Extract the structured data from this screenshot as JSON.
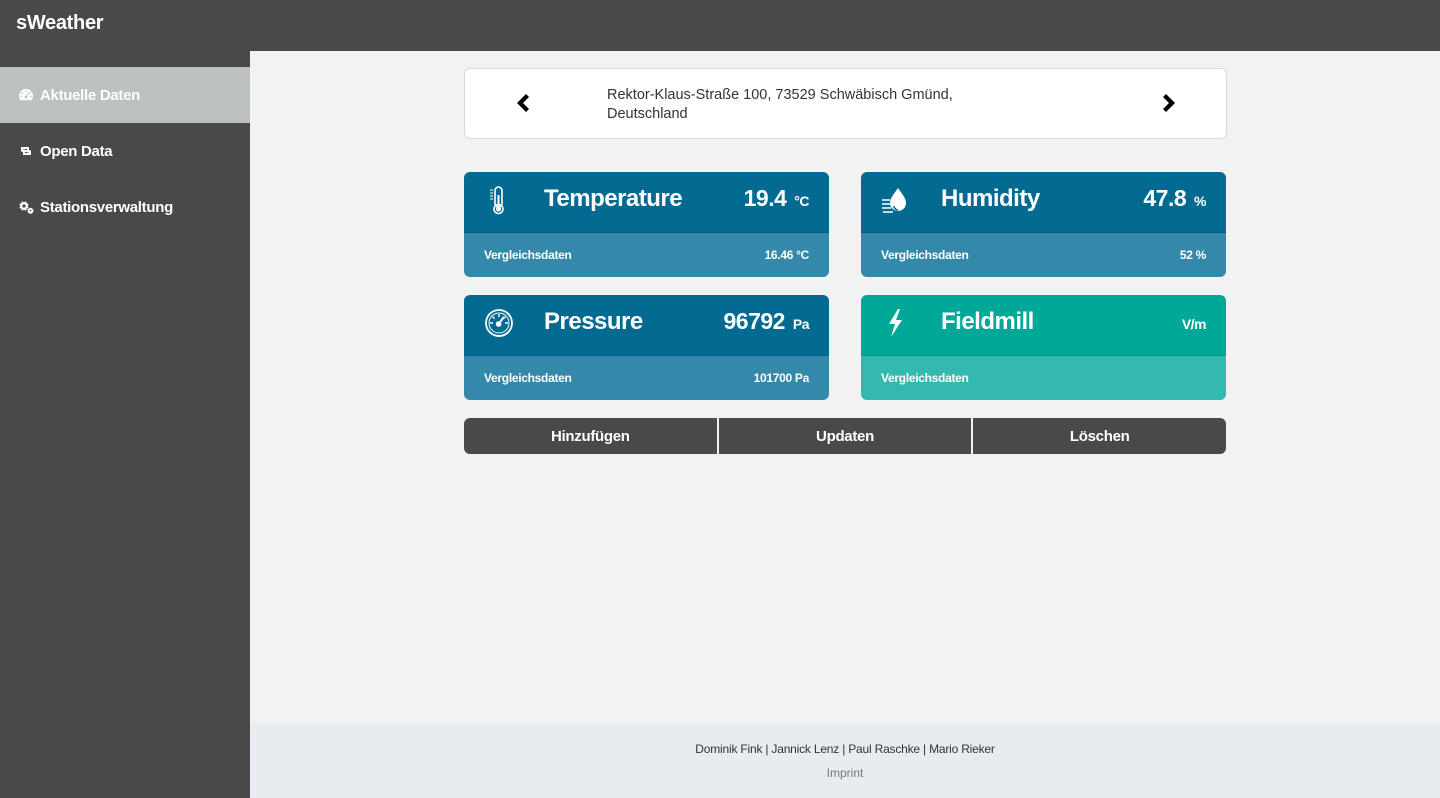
{
  "app": {
    "title": "sWeather"
  },
  "sidebar": {
    "items": [
      {
        "label": "Aktuelle Daten",
        "icon": "dashboard-icon",
        "active": true
      },
      {
        "label": "Open Data",
        "icon": "retweet-icon",
        "active": false
      },
      {
        "label": "Stationsverwaltung",
        "icon": "cogs-icon",
        "active": false
      }
    ]
  },
  "location": {
    "address": "Rektor-Klaus-Straße 100, 73529 Schwäbisch Gmünd, Deutschland",
    "prev_icon": "chevron-left-icon",
    "next_icon": "chevron-right-icon"
  },
  "cards": {
    "temperature": {
      "title": "Temperature",
      "value": "19.4",
      "unit": "°C",
      "compare_label": "Vergleichsdaten",
      "compare_value": "16.46 °C",
      "icon": "thermometer-icon"
    },
    "humidity": {
      "title": "Humidity",
      "value": "47.8",
      "unit": "%",
      "compare_label": "Vergleichsdaten",
      "compare_value": "52 %",
      "icon": "humidity-icon"
    },
    "pressure": {
      "title": "Pressure",
      "value": "96792",
      "unit": "Pa",
      "compare_label": "Vergleichsdaten",
      "compare_value": "101700 Pa",
      "icon": "gauge-icon"
    },
    "fieldmill": {
      "title": "Fieldmill",
      "value": "",
      "unit": "V/m",
      "compare_label": "Vergleichsdaten",
      "compare_value": "",
      "icon": "lightning-icon"
    }
  },
  "actions": {
    "add": "Hinzufügen",
    "update": "Updaten",
    "delete": "Löschen"
  },
  "footer": {
    "authors": "Dominik Fink | Jannick Lenz | Paul Raschke | Mario Rieker",
    "imprint": "Imprint"
  },
  "colors": {
    "sidebar": "#4a4849",
    "active_item": "#bec1c1",
    "card_blue": "#036b92",
    "card_blue_light": "#3488a9",
    "card_teal": "#00a898",
    "card_teal_light": "#33b9ad"
  }
}
